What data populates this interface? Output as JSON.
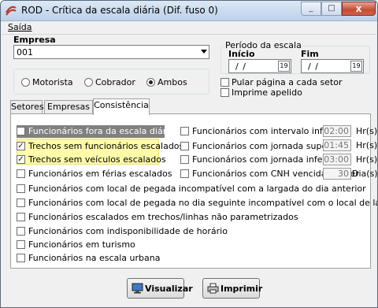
{
  "window": {
    "title": "ROD - Crítica da escala diária (Dif. fuso 0)",
    "close": "x",
    "min": "_",
    "max": "□"
  },
  "menu": {
    "saida": "Saída"
  },
  "empresa": {
    "label": "Empresa",
    "value": "001"
  },
  "periodo": {
    "title": "Período da escala",
    "inicio_label": "Início",
    "fim_label": "Fim",
    "inicio_value": "/ /",
    "fim_value": "/ /",
    "calendar": "19"
  },
  "funcao": {
    "options": [
      {
        "label": "Motorista",
        "checked": false
      },
      {
        "label": "Cobrador",
        "checked": false
      },
      {
        "label": "Ambos",
        "checked": true
      }
    ]
  },
  "options": {
    "pular": {
      "label": "Pular página a cada setor",
      "checked": false
    },
    "apelido": {
      "label": "Imprime apelido",
      "checked": false
    }
  },
  "tabs": [
    {
      "label": "Setores",
      "active": false
    },
    {
      "label": "Empresas",
      "active": false
    },
    {
      "label": "Consistência",
      "active": true
    }
  ],
  "left_checks": [
    {
      "label": "Funcionários fora da escala diária",
      "checked": false
    },
    {
      "label": "Trechos sem funcionários escalados",
      "checked": true
    },
    {
      "label": "Trechos sem veículos escalados",
      "checked": true
    },
    {
      "label": "Funcionários em férias escalados",
      "checked": false
    }
  ],
  "right_checks": [
    {
      "label": "Funcionários com intervalo inferior a",
      "checked": false,
      "value": "02:00",
      "unit": "Hr(s)"
    },
    {
      "label": "Funcionários com jornada superior a",
      "checked": false,
      "value": "01:45",
      "unit": "Hr(s)"
    },
    {
      "label": "Funcionários com jornada inferior a",
      "checked": false,
      "value": "03:00",
      "unit": "Hr(s)"
    },
    {
      "label": "Funcionários com CNH vencida/vencer",
      "checked": false,
      "value": "30",
      "unit": "Dia(s)"
    }
  ],
  "full_checks": [
    {
      "label": "Funcionários com local de pegada incompatível com a largada do dia anterior",
      "checked": false
    },
    {
      "label": "Funcionários com local de pegada no dia seguinte incompatível com o local de largada na data",
      "checked": false
    },
    {
      "label": "Funcionários escalados em trechos/linhas não parametrizados",
      "checked": false
    },
    {
      "label": "Funcionários com indisponibilidade de horário",
      "checked": false
    },
    {
      "label": "Funcionários em turismo",
      "checked": false
    },
    {
      "label": "Funcionários na escala urbana",
      "checked": false
    }
  ],
  "buttons": {
    "visualizar": "Visualizar",
    "imprimir": "Imprimir"
  },
  "colors": {
    "highlight": "#fdfaaa",
    "close": "#c44b33"
  }
}
